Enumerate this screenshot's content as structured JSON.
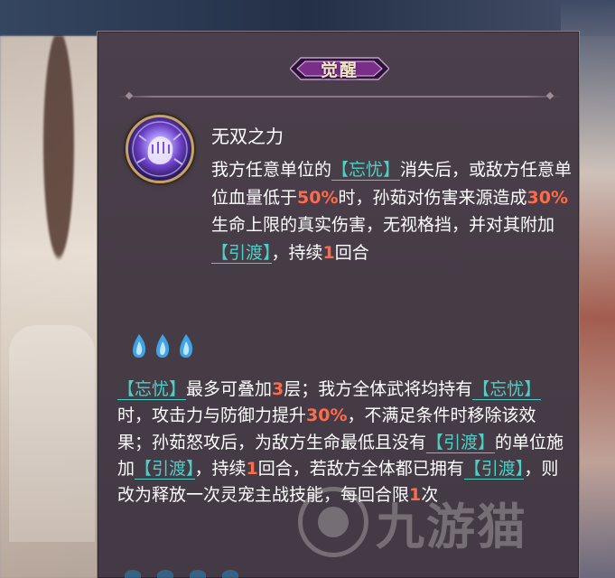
{
  "panel": {
    "title": "觉醒",
    "skill": {
      "icon": "purple-energy-fist-icon",
      "name": "无双之力",
      "description": [
        {
          "t": "我方任意单位的"
        },
        {
          "t": "【忘忧】",
          "kw": true
        },
        {
          "t": "消失后，或敌方任意单位血量低于"
        },
        {
          "t": "50%",
          "num": true
        },
        {
          "t": "时，孙茹对伤害来源造成"
        },
        {
          "t": "30%",
          "num": true
        },
        {
          "t": "生命上限的真实伤害，无视格挡，并对其附加"
        },
        {
          "t": "【引渡】",
          "kw": true
        },
        {
          "t": "，持续"
        },
        {
          "t": "1",
          "num": true
        },
        {
          "t": "回合"
        }
      ]
    },
    "flames": [
      "blue-flame-icon",
      "blue-flame-icon",
      "blue-flame-icon"
    ],
    "note": [
      {
        "t": "【忘忧】",
        "kw": true
      },
      {
        "t": "最多可叠加"
      },
      {
        "t": "3",
        "num": true
      },
      {
        "t": "层；我方全体武将均持有"
      },
      {
        "t": "【忘忧】",
        "kw": true
      },
      {
        "t": "时，攻击力与防御力提升"
      },
      {
        "t": "30%",
        "num": true
      },
      {
        "t": "，不满足条件时移除该效果；孙茹怒攻后，为敌方生命最低且没有"
      },
      {
        "t": "【引渡】",
        "kw": true
      },
      {
        "t": "的单位施加"
      },
      {
        "t": "【引渡】",
        "kw": true
      },
      {
        "t": "，持续"
      },
      {
        "t": "1",
        "num": true
      },
      {
        "t": "回合，若敌方全体都已拥有"
      },
      {
        "t": "【引渡】",
        "kw": true
      },
      {
        "t": "，则改为释放一次灵宠主战技能，每回合限"
      },
      {
        "t": "1",
        "num": true
      },
      {
        "t": "次"
      }
    ]
  },
  "watermark": {
    "logo": "site-logo-icon",
    "text": "九游猫"
  },
  "colors": {
    "keyword": "#4fd0c6",
    "number": "#ff6a4a",
    "text": "#ffffff",
    "panel": "#473d47",
    "ribbon": "#6b2f7a"
  }
}
